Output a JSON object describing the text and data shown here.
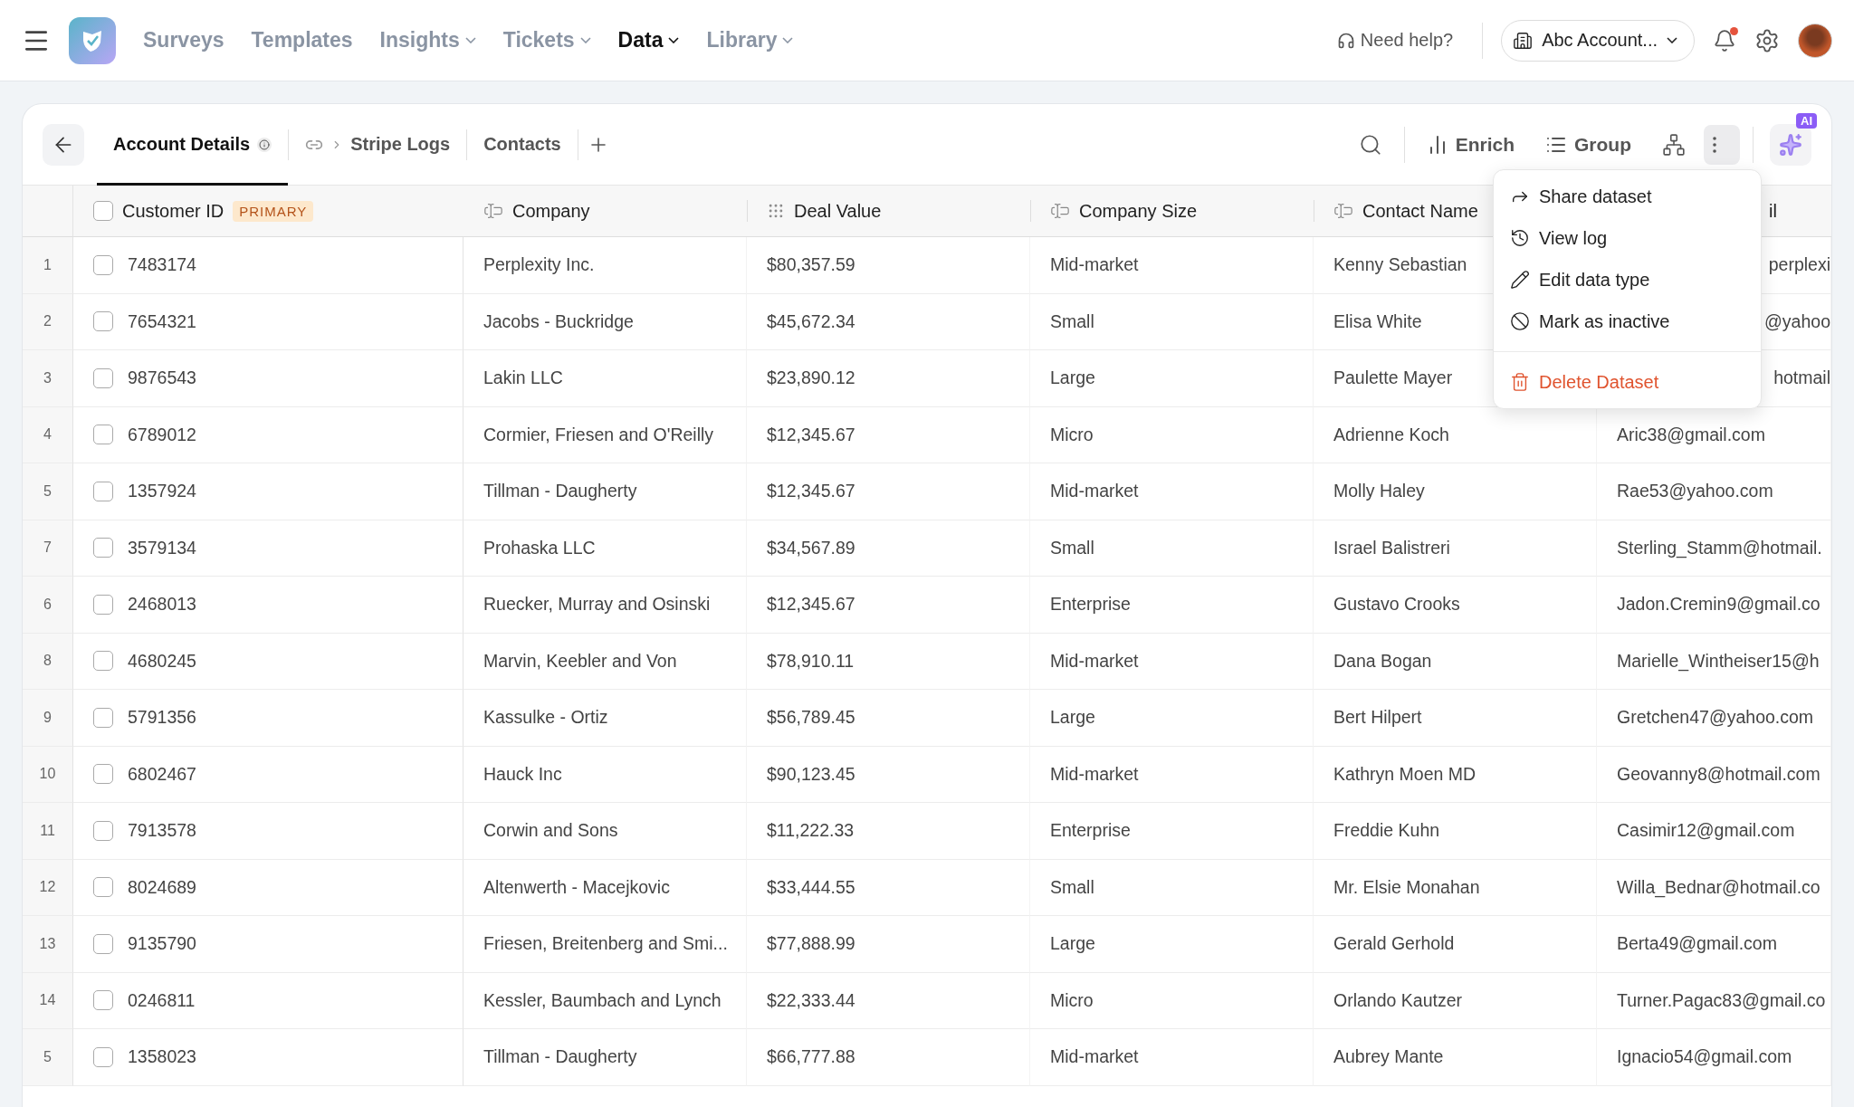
{
  "nav": {
    "items": [
      {
        "label": "Surveys",
        "dropdown": false,
        "selected": false
      },
      {
        "label": "Templates",
        "dropdown": false,
        "selected": false
      },
      {
        "label": "Insights",
        "dropdown": true,
        "selected": false
      },
      {
        "label": "Tickets",
        "dropdown": true,
        "selected": false
      },
      {
        "label": "Data",
        "dropdown": true,
        "selected": true
      },
      {
        "label": "Library",
        "dropdown": true,
        "selected": false
      }
    ],
    "help": "Need help?",
    "account": "Abc Account...",
    "unread": true
  },
  "tabs": [
    {
      "label": "Account Details",
      "selected": true,
      "info": true,
      "linked": false
    },
    {
      "label": "Stripe Logs",
      "selected": false,
      "info": false,
      "linked": true
    },
    {
      "label": "Contacts",
      "selected": false,
      "info": false,
      "linked": false
    }
  ],
  "toolbar": {
    "enrich": "Enrich",
    "group": "Group",
    "ai_badge": "AI",
    "more_open": true
  },
  "menu": [
    {
      "label": "Share dataset",
      "kind": "share"
    },
    {
      "label": "View log",
      "kind": "log"
    },
    {
      "label": "Edit data type",
      "kind": "edit"
    },
    {
      "label": "Mark as inactive",
      "kind": "inactive"
    },
    {
      "label": "Delete Dataset",
      "kind": "delete"
    }
  ],
  "table": {
    "primary_badge": "PRIMARY",
    "all_checked": false,
    "columns": [
      {
        "label": "Customer ID",
        "kind": "id"
      },
      {
        "label": "Company",
        "kind": "text"
      },
      {
        "label": "Deal Value",
        "kind": "number"
      },
      {
        "label": "Company Size",
        "kind": "text"
      },
      {
        "label": "Contact Name",
        "kind": "text"
      },
      {
        "label": "il",
        "kind": "covered"
      }
    ],
    "rows": [
      {
        "number": "1",
        "checked": false,
        "cells": [
          "7483174",
          "Perplexity Inc.",
          "$80,357.59",
          "Mid-market",
          "Kenny Sebastian",
          "perplexi"
        ]
      },
      {
        "number": "2",
        "checked": false,
        "cells": [
          "7654321",
          "Jacobs - Buckridge",
          "$45,672.34",
          "Small",
          "Elisa White",
          "@yahoo"
        ]
      },
      {
        "number": "3",
        "checked": false,
        "cells": [
          "9876543",
          "Lakin LLC",
          "$23,890.12",
          "Large",
          "Paulette Mayer",
          "hotmail"
        ]
      },
      {
        "number": "4",
        "checked": false,
        "cells": [
          "6789012",
          "Cormier, Friesen and O'Reilly",
          "$12,345.67",
          "Micro",
          "Adrienne Koch",
          "Aric38@gmail.com"
        ]
      },
      {
        "number": "5",
        "checked": false,
        "cells": [
          "1357924",
          "Tillman - Daugherty",
          "$12,345.67",
          "Mid-market",
          "Molly Haley",
          "Rae53@yahoo.com"
        ]
      },
      {
        "number": "7",
        "checked": false,
        "cells": [
          "3579134",
          "Prohaska LLC",
          "$34,567.89",
          "Small",
          "Israel Balistreri",
          "Sterling_Stamm@hotmail."
        ]
      },
      {
        "number": "6",
        "checked": false,
        "cells": [
          "2468013",
          "Ruecker, Murray and Osinski",
          "$12,345.67",
          "Enterprise",
          "Gustavo Crooks",
          "Jadon.Cremin9@gmail.co"
        ]
      },
      {
        "number": "8",
        "checked": false,
        "cells": [
          "4680245",
          "Marvin, Keebler and Von",
          "$78,910.11",
          "Mid-market",
          "Dana Bogan",
          "Marielle_Wintheiser15@h"
        ]
      },
      {
        "number": "9",
        "checked": false,
        "cells": [
          "5791356",
          "Kassulke - Ortiz",
          "$56,789.45",
          "Large",
          "Bert Hilpert",
          "Gretchen47@yahoo.com"
        ]
      },
      {
        "number": "10",
        "checked": false,
        "cells": [
          "6802467",
          "Hauck Inc",
          "$90,123.45",
          "Mid-market",
          "Kathryn Moen MD",
          "Geovanny8@hotmail.com"
        ]
      },
      {
        "number": "11",
        "checked": false,
        "cells": [
          "7913578",
          "Corwin and Sons",
          "$11,222.33",
          "Enterprise",
          "Freddie Kuhn",
          "Casimir12@gmail.com"
        ]
      },
      {
        "number": "12",
        "checked": false,
        "cells": [
          "8024689",
          "Altenwerth - Macejkovic",
          "$33,444.55",
          "Small",
          "Mr. Elsie Monahan",
          "Willa_Bednar@hotmail.co"
        ]
      },
      {
        "number": "13",
        "checked": false,
        "cells": [
          "9135790",
          "Friesen, Breitenberg and Smi...",
          "$77,888.99",
          "Large",
          "Gerald Gerhold",
          "Berta49@gmail.com"
        ]
      },
      {
        "number": "14",
        "checked": false,
        "cells": [
          "0246811",
          "Kessler, Baumbach and Lynch",
          "$22,333.44",
          "Micro",
          "Orlando Kautzer",
          "Turner.Pagac83@gmail.co"
        ]
      },
      {
        "number": "5",
        "checked": false,
        "cells": [
          "1358023",
          "Tillman - Daugherty",
          "$66,777.88",
          "Mid-market",
          "Aubrey Mante",
          "Ignacio54@gmail.com"
        ]
      }
    ]
  }
}
